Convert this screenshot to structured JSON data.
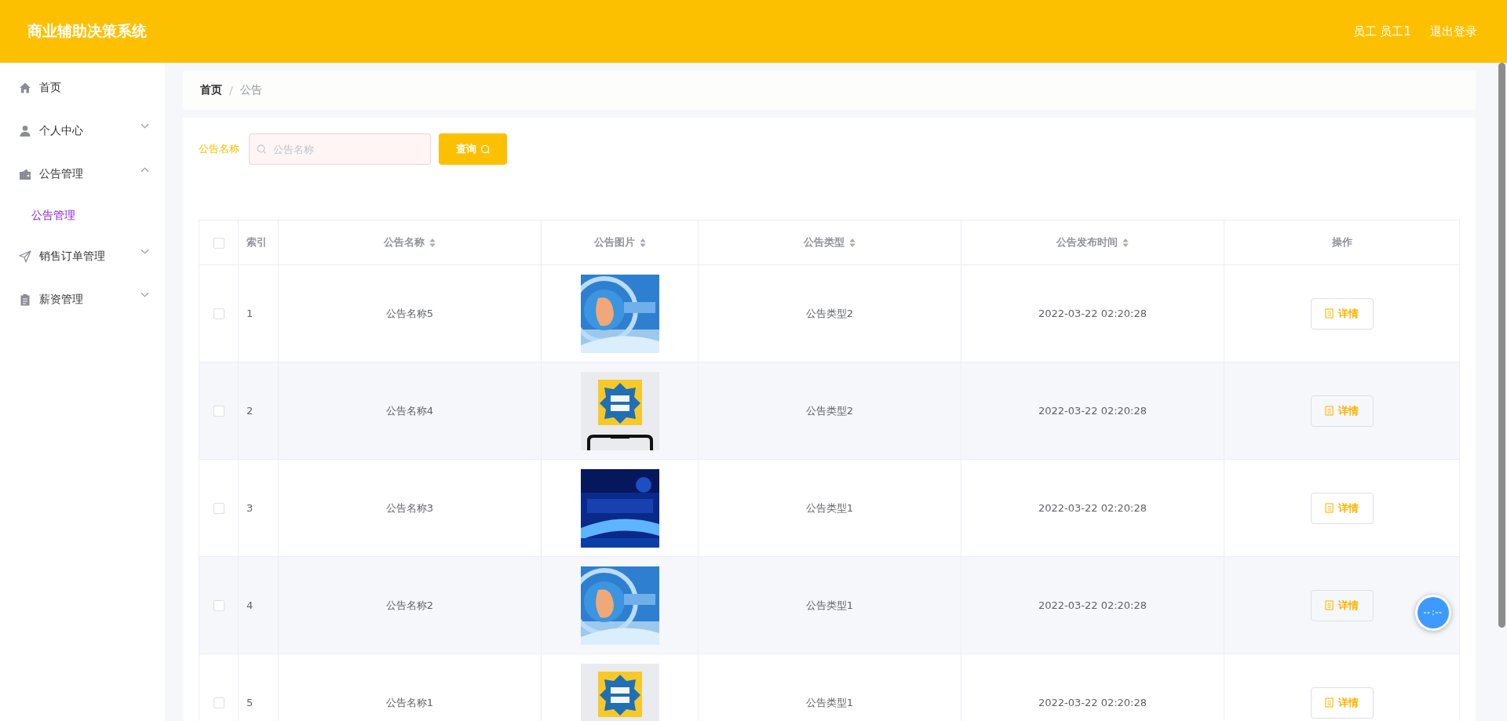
{
  "header": {
    "title": "商业辅助决策系统",
    "user": "员工 员工1",
    "logout": "退出登录"
  },
  "sidebar": {
    "items": [
      {
        "label": "首页"
      },
      {
        "label": "个人中心",
        "expanded": false
      },
      {
        "label": "公告管理",
        "expanded": true,
        "children": [
          {
            "label": "公告管理",
            "selected": true
          }
        ]
      },
      {
        "label": "销售订单管理",
        "expanded": false
      },
      {
        "label": "薪资管理",
        "expanded": false
      }
    ]
  },
  "breadcrumb": {
    "separator": "/",
    "items": [
      {
        "label": "首页"
      },
      {
        "label": "公告"
      }
    ]
  },
  "search": {
    "label": "公告名称",
    "placeholder": "公告名称",
    "button": "查询"
  },
  "table": {
    "select_all": {
      "checked": false
    },
    "columns": [
      {
        "label": "索引",
        "sortable": false
      },
      {
        "label": "公告名称",
        "sortable": true
      },
      {
        "label": "公告图片",
        "sortable": true
      },
      {
        "label": "公告类型",
        "sortable": true
      },
      {
        "label": "公告发布时间",
        "sortable": true
      },
      {
        "label": "操作",
        "sortable": false
      }
    ],
    "rows": [
      {
        "checked": false,
        "index": "1",
        "name": "公告名称5",
        "type": "公告类型2",
        "time": "2022-03-22 02:20:28",
        "action": "详情"
      },
      {
        "checked": false,
        "index": "2",
        "name": "公告名称4",
        "type": "公告类型2",
        "time": "2022-03-22 02:20:28",
        "action": "详情"
      },
      {
        "checked": false,
        "index": "3",
        "name": "公告名称3",
        "type": "公告类型1",
        "time": "2022-03-22 02:20:28",
        "action": "详情"
      },
      {
        "checked": false,
        "index": "4",
        "name": "公告名称2",
        "type": "公告类型1",
        "time": "2022-03-22 02:20:28",
        "action": "详情"
      },
      {
        "checked": false,
        "index": "5",
        "name": "公告名称1",
        "type": "公告类型1",
        "time": "2022-03-22 02:20:28",
        "action": "详情"
      }
    ]
  }
}
